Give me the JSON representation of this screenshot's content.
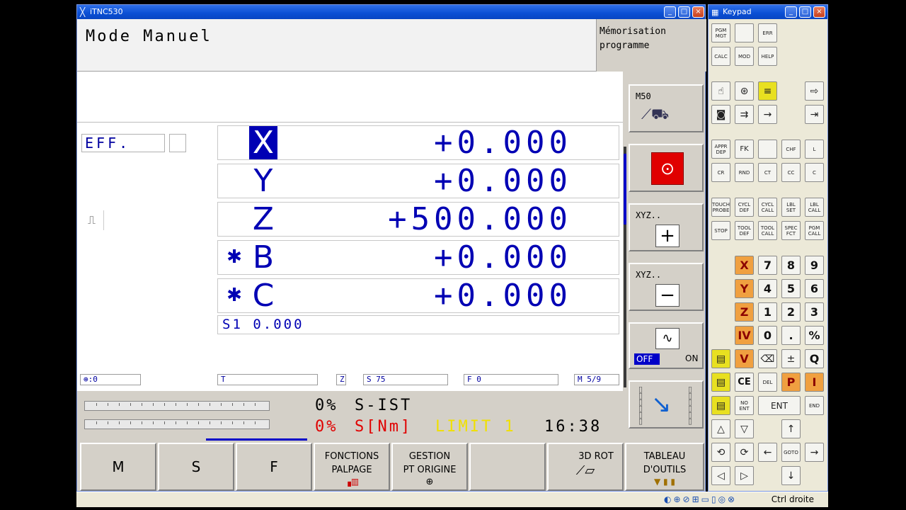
{
  "window": {
    "title": "iTNC530",
    "min": "_",
    "max": "□",
    "close": "×"
  },
  "header": {
    "mode": "Mode Manuel",
    "memo": "Mémorisation programme"
  },
  "eff": "EFF.",
  "axes": [
    {
      "name": "X",
      "value": "+0.000",
      "icon": ""
    },
    {
      "name": "Y",
      "value": "+0.000",
      "icon": ""
    },
    {
      "name": "Z",
      "value": "+500.000",
      "icon": ""
    },
    {
      "name": "B",
      "value": "+0.000",
      "icon": "✱"
    },
    {
      "name": "C",
      "value": "+0.000",
      "icon": "✱"
    }
  ],
  "spindle": "S1   0.000",
  "status": {
    "coord": "⊕:0",
    "tool": "T",
    "axis": "Z",
    "speed": "S 75",
    "feed": "F 0",
    "mfunc": "M 5/9"
  },
  "readouts": {
    "line1_pct": "0%",
    "line1_label": "S-IST",
    "line2_pct": "0%",
    "line2_label": "S[Nm]",
    "limit": "LIMIT 1",
    "time": "16:38"
  },
  "softkeys": [
    {
      "label": "M"
    },
    {
      "label": "S"
    },
    {
      "label": "F"
    },
    {
      "line1": "FONCTIONS",
      "line2": "PALPAGE"
    },
    {
      "line1": "GESTION",
      "line2": "PT ORIGINE"
    },
    {
      "label": ""
    },
    {
      "line1": "3D ROT",
      "line2": ""
    },
    {
      "line1": "TABLEAU",
      "line2": "D'OUTILS"
    }
  ],
  "vsoftkeys": {
    "m50": "M50",
    "xyz_plus": "XYZ..",
    "xyz_minus": "XYZ..",
    "off": "OFF",
    "on": "ON"
  },
  "keypad": {
    "title": "Keypad",
    "top_keys": [
      "PGM MGT",
      "",
      "ERR",
      "CALC",
      "MOD",
      "HELP"
    ],
    "prog_keys": [
      "APPR DEP",
      "FK",
      "",
      "CHF",
      "L",
      "CR",
      "RND",
      "CT",
      "CC",
      "C"
    ],
    "cycle_keys": [
      "TOUCH PROBE",
      "CYCL DEF",
      "CYCL CALL",
      "LBL SET",
      "LBL CALL",
      "STOP",
      "TOOL DEF",
      "TOOL CALL",
      "SPEC FCT",
      "PGM CALL"
    ],
    "axis_keys": [
      "X",
      "Y",
      "Z",
      "IV",
      "V"
    ],
    "num_rows": [
      [
        "7",
        "8",
        "9"
      ],
      [
        "4",
        "5",
        "6"
      ],
      [
        "1",
        "2",
        "3"
      ],
      [
        "0",
        ".",
        "%"
      ]
    ],
    "misc": {
      "ce": "CE",
      "del": "DEL",
      "p": "P",
      "i": "I",
      "noent": "NO ENT",
      "ent": "ENT",
      "end": "END",
      "goto": "GOTO",
      "q": "Q"
    }
  },
  "taskbar": {
    "tray_text": "Ctrl droite"
  }
}
